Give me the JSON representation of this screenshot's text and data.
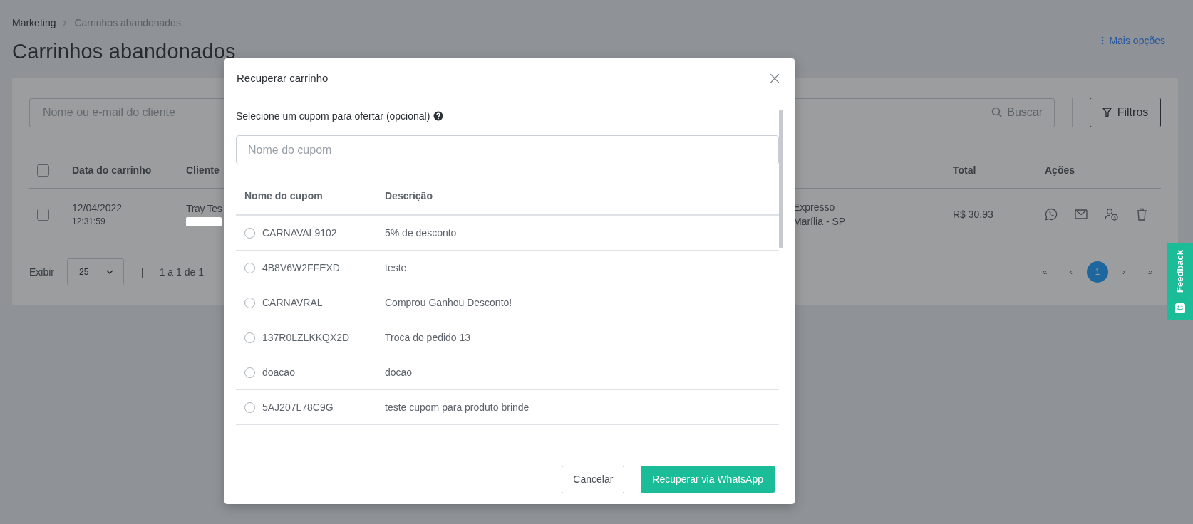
{
  "breadcrumb": [
    {
      "label": "Marketing"
    },
    {
      "label": "Carrinhos abandonados"
    }
  ],
  "page_title": "Carrinhos abandonados",
  "more_options": "Mais opções",
  "search": {
    "placeholder": "Nome ou e-mail do cliente",
    "button": "Buscar"
  },
  "filters_button": "Filtros",
  "table": {
    "all_checked": false,
    "columns": [
      "Data do carrinho",
      "Cliente",
      "Total",
      "Ações"
    ],
    "rows": [
      {
        "checked": false,
        "date": "12/04/2022",
        "time": "12:31:59",
        "client": "Tray Tes",
        "shipping": [
          "Expresso",
          "Marília - SP"
        ],
        "total": "R$ 30,93"
      }
    ]
  },
  "pagination": {
    "show_label": "Exibir",
    "per_page": "25",
    "separator": "|",
    "range": "1 a 1 de 1",
    "first": "«",
    "prev": "‹",
    "next": "›",
    "last": "»",
    "pages": [
      {
        "label": "1",
        "selected": true
      }
    ]
  },
  "feedback_tab": "Feedback",
  "modal": {
    "title": "Recuperar carrinho",
    "close": "×",
    "prompt": "Selecione um cupom para ofertar (opcional)",
    "coupon_search": {
      "placeholder": "Nome do cupom"
    },
    "columns": [
      "Nome do cupom",
      "Descrição"
    ],
    "coupons": [
      {
        "name": "CARNAVAL9102",
        "description": "5% de desconto",
        "selected": false
      },
      {
        "name": "4B8V6W2FFEXD",
        "description": "teste",
        "selected": false
      },
      {
        "name": "CARNAVRAL",
        "description": "Comprou Ganhou Desconto!",
        "selected": false
      },
      {
        "name": "137R0LZLKKQX2D",
        "description": "Troca do pedido 13",
        "selected": false
      },
      {
        "name": "doacao",
        "description": "docao",
        "selected": false
      },
      {
        "name": "5AJ207L78C9G",
        "description": "teste cupom para produto brinde",
        "selected": false
      }
    ],
    "cancel_button": "Cancelar",
    "confirm_button": "Recuperar via WhatsApp"
  }
}
